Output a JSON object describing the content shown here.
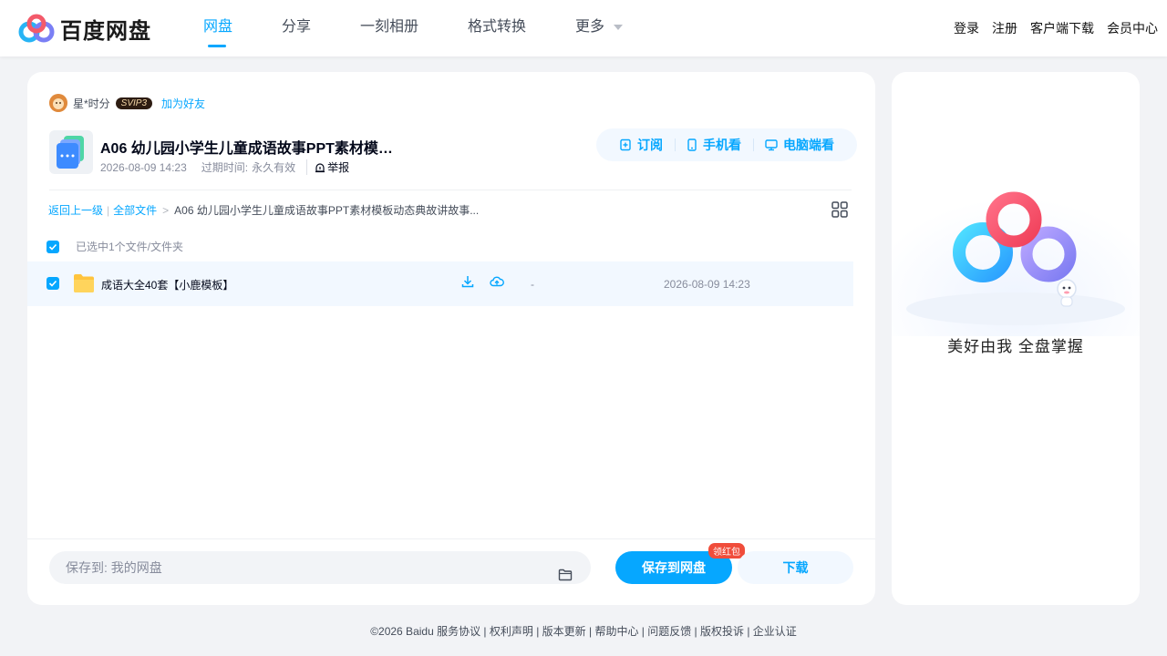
{
  "header": {
    "logo_text": "百度网盘",
    "nav": [
      "网盘",
      "分享",
      "一刻相册",
      "格式转换",
      "更多"
    ],
    "right_links": [
      "登录",
      "注册",
      "客户端下载",
      "会员中心"
    ]
  },
  "owner": {
    "name": "星*时分",
    "badge": "SVIP3",
    "add_friend": "加为好友"
  },
  "file": {
    "title": "A06 幼儿园小学生儿童成语故事PPT素材模…",
    "date": "2026-08-09 14:23",
    "expire_label": "过期时间:",
    "expire_value": "永久有效",
    "report": "举报"
  },
  "actions": {
    "subscribe": "订阅",
    "mobile": "手机看",
    "desktop": "电脑端看"
  },
  "breadcrumb": {
    "back": "返回上一级",
    "all": "全部文件",
    "current": "A06 幼儿园小学生儿童成语故事PPT素材模板动态典故讲故事..."
  },
  "selection": {
    "label": "已选中1个文件/文件夹"
  },
  "files": [
    {
      "name": "成语大全40套【小鹿模板】",
      "size": "-",
      "date": "2026-08-09 14:23"
    }
  ],
  "bottom": {
    "save_to_label": "保存到:",
    "save_to_value": "我的网盘",
    "save_button": "保存到网盘",
    "badge": "领红包",
    "download_button": "下载"
  },
  "side": {
    "slogan": "美好由我  全盘掌握"
  },
  "footer": {
    "text": "©2026 Baidu  服务协议 | 权利声明 | 版本更新 | 帮助中心 | 问题反馈 | 版权投诉 | 企业认证"
  },
  "colors": {
    "accent": "#06a7ff",
    "text_main": "#03081a",
    "text_muted": "#878c9c",
    "row_highlight": "#f2f8ff"
  }
}
